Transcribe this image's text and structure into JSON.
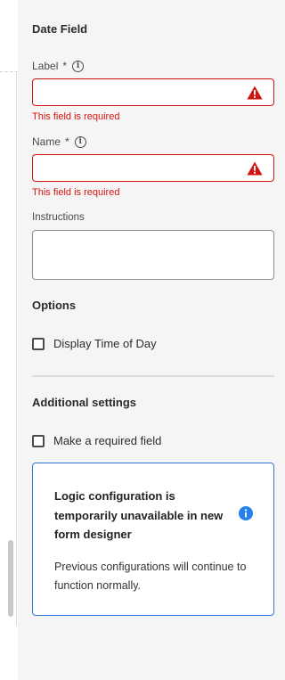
{
  "panel": {
    "title": "Date Field",
    "label_field": {
      "label": "Label",
      "required_marker": "*",
      "value": "",
      "error": "This field is required"
    },
    "name_field": {
      "label": "Name",
      "required_marker": "*",
      "value": "",
      "error": "This field is required"
    },
    "instructions_field": {
      "label": "Instructions",
      "value": ""
    },
    "options": {
      "heading": "Options",
      "display_time_of_day": {
        "label": "Display Time of Day",
        "checked": false
      }
    },
    "additional_settings": {
      "heading": "Additional settings",
      "make_required": {
        "label": "Make a required field",
        "checked": false
      }
    },
    "info_box": {
      "title": "Logic configuration is temporarily unavailable in new form designer",
      "body": "Previous configurations will continue to function normally."
    }
  },
  "colors": {
    "error": "#d31510",
    "info_border": "#2f76d6",
    "info_icon": "#2680eb"
  },
  "icons": [
    "info-outline-icon",
    "alert-triangle-icon",
    "info-filled-icon"
  ]
}
